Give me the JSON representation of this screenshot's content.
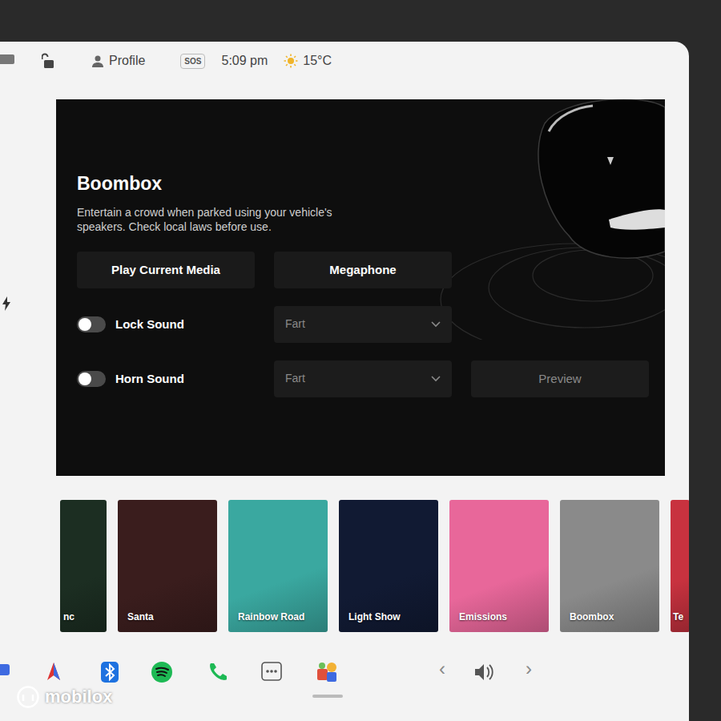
{
  "status_bar": {
    "locked": false,
    "profile": "Profile",
    "sos": "SOS",
    "time": "5:09 pm",
    "temperature": "15°C"
  },
  "panel": {
    "title": "Boombox",
    "description": "Entertain a crowd when parked using your vehicle's speakers. Check local laws before use.",
    "buttons": [
      {
        "label": "Play Current Media"
      },
      {
        "label": "Megaphone"
      }
    ],
    "settings": [
      {
        "label": "Lock Sound",
        "on": false,
        "value": "Fart"
      },
      {
        "label": "Horn Sound",
        "on": false,
        "value": "Fart"
      }
    ],
    "preview": {
      "label": "Preview",
      "disabled": true
    }
  },
  "tiles": [
    {
      "label": "nc",
      "color": "#1c2e22"
    },
    {
      "label": "Santa",
      "color": "#3a1d1d"
    },
    {
      "label": "Rainbow Road",
      "color": "#3aa8a0"
    },
    {
      "label": "Light Show",
      "color": "#111a33"
    },
    {
      "label": "Emissions",
      "color": "#e8679a"
    },
    {
      "label": "Boombox",
      "color": "#8a8a8a"
    },
    {
      "label": "Te",
      "color": "#c8323f"
    }
  ],
  "taskbar": {
    "prev": "‹",
    "next": "›",
    "toybox_active": true
  },
  "watermark": "mobilox"
}
